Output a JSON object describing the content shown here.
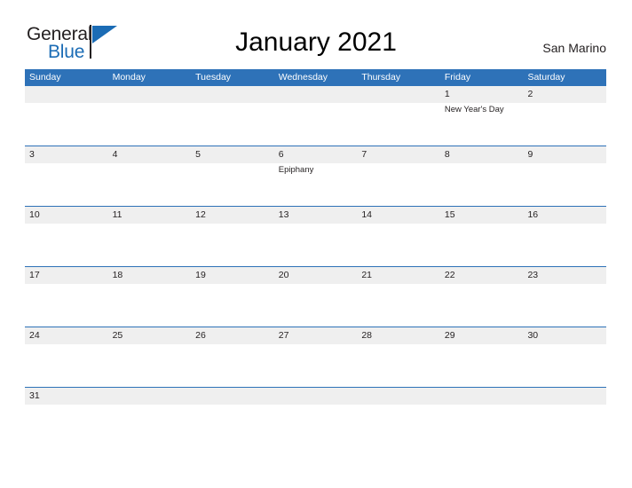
{
  "brand": {
    "name_part1": "General",
    "name_part2": "Blue",
    "accent_color": "#1b6cb5"
  },
  "header": {
    "title": "January 2021",
    "location": "San Marino"
  },
  "theme": {
    "header_blue": "#2e72b8",
    "row_band_gray": "#efefef",
    "rule_blue": "#2e72b8"
  },
  "calendar": {
    "month": "January",
    "year": "2021",
    "weekday_headers": [
      "Sunday",
      "Monday",
      "Tuesday",
      "Wednesday",
      "Thursday",
      "Friday",
      "Saturday"
    ],
    "weeks": [
      {
        "days": [
          {
            "num": "",
            "event": ""
          },
          {
            "num": "",
            "event": ""
          },
          {
            "num": "",
            "event": ""
          },
          {
            "num": "",
            "event": ""
          },
          {
            "num": "",
            "event": ""
          },
          {
            "num": "1",
            "event": "New Year's Day"
          },
          {
            "num": "2",
            "event": ""
          }
        ]
      },
      {
        "days": [
          {
            "num": "3",
            "event": ""
          },
          {
            "num": "4",
            "event": ""
          },
          {
            "num": "5",
            "event": ""
          },
          {
            "num": "6",
            "event": "Epiphany"
          },
          {
            "num": "7",
            "event": ""
          },
          {
            "num": "8",
            "event": ""
          },
          {
            "num": "9",
            "event": ""
          }
        ]
      },
      {
        "days": [
          {
            "num": "10",
            "event": ""
          },
          {
            "num": "11",
            "event": ""
          },
          {
            "num": "12",
            "event": ""
          },
          {
            "num": "13",
            "event": ""
          },
          {
            "num": "14",
            "event": ""
          },
          {
            "num": "15",
            "event": ""
          },
          {
            "num": "16",
            "event": ""
          }
        ]
      },
      {
        "days": [
          {
            "num": "17",
            "event": ""
          },
          {
            "num": "18",
            "event": ""
          },
          {
            "num": "19",
            "event": ""
          },
          {
            "num": "20",
            "event": ""
          },
          {
            "num": "21",
            "event": ""
          },
          {
            "num": "22",
            "event": ""
          },
          {
            "num": "23",
            "event": ""
          }
        ]
      },
      {
        "days": [
          {
            "num": "24",
            "event": ""
          },
          {
            "num": "25",
            "event": ""
          },
          {
            "num": "26",
            "event": ""
          },
          {
            "num": "27",
            "event": ""
          },
          {
            "num": "28",
            "event": ""
          },
          {
            "num": "29",
            "event": ""
          },
          {
            "num": "30",
            "event": ""
          }
        ]
      },
      {
        "last": true,
        "days": [
          {
            "num": "31",
            "event": ""
          },
          {
            "num": "",
            "event": ""
          },
          {
            "num": "",
            "event": ""
          },
          {
            "num": "",
            "event": ""
          },
          {
            "num": "",
            "event": ""
          },
          {
            "num": "",
            "event": ""
          },
          {
            "num": "",
            "event": ""
          }
        ]
      }
    ]
  }
}
